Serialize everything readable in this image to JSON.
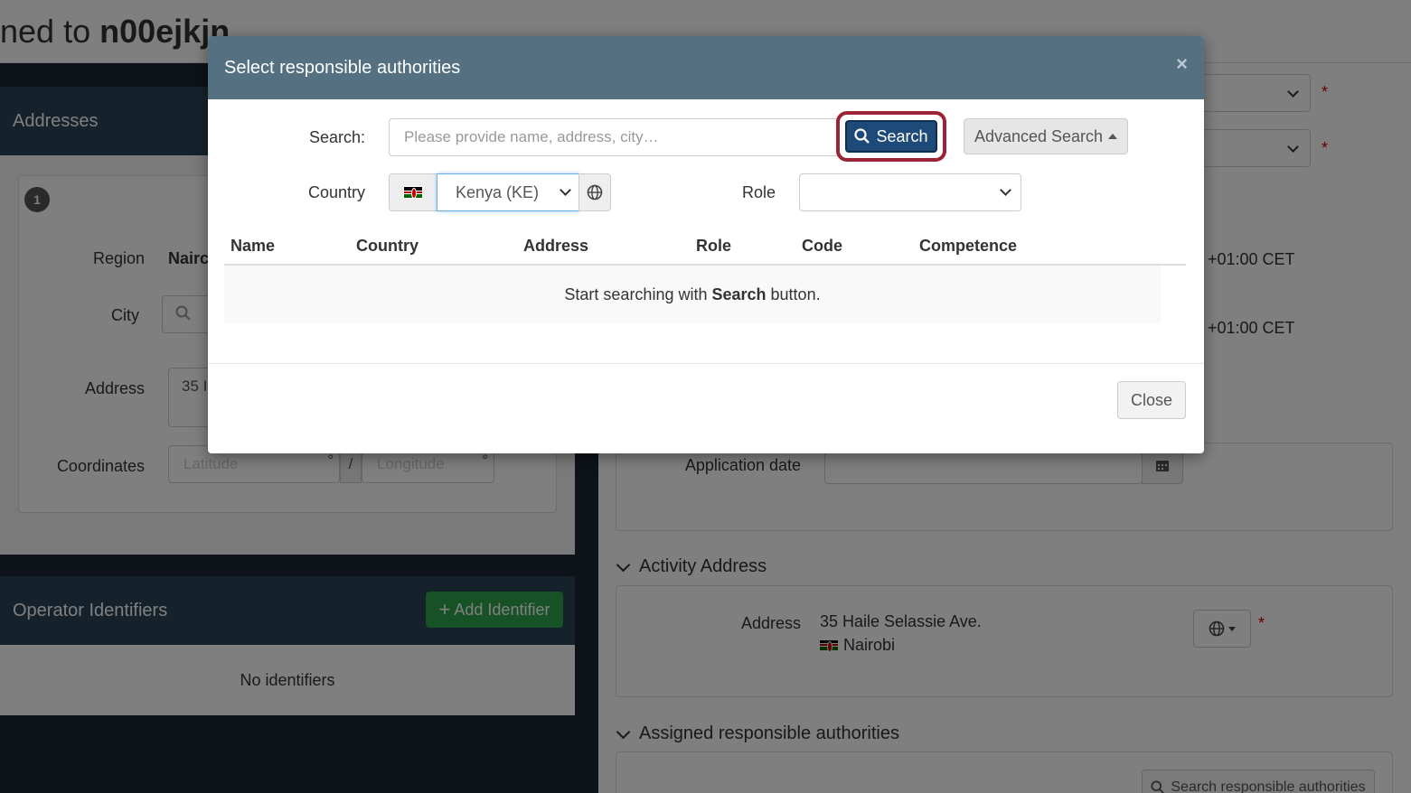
{
  "page": {
    "title_prefix": "ned to",
    "title_user": "n00ejkjn"
  },
  "addresses_panel": {
    "title": "Addresses",
    "index": "1",
    "region_label": "Region",
    "region_value": "Nairc",
    "city_label": "City",
    "address_label": "Address",
    "address_value": "35 I",
    "coordinates_label": "Coordinates",
    "latitude_placeholder": "Latitude",
    "longitude_placeholder": "Longitude",
    "degree_symbol": "°",
    "separator": "/"
  },
  "operator_identifiers": {
    "title": "Operator Identifiers",
    "add_button": "Add Identifier",
    "empty_text": "No identifiers"
  },
  "right_column": {
    "timezone_1": "+01:00 CET",
    "timezone_2": "+01:00 CET",
    "application_date_label": "Application date",
    "activity_address_title": "Activity Address",
    "address_label": "Address",
    "address_line1": "35 Haile Selassie Ave.",
    "address_line2": "Nairobi",
    "assigned_title": "Assigned responsible authorities",
    "search_authorities_button": "Search responsible authorities",
    "required_mark": "*"
  },
  "modal": {
    "title": "Select responsible authorities",
    "close_x": "×",
    "search_label": "Search:",
    "search_placeholder": "Please provide name, address, city…",
    "search_button": "Search",
    "advanced_search_button": "Advanced Search",
    "country_label": "Country",
    "country_value": "Kenya (KE)",
    "role_label": "Role",
    "role_value": "",
    "columns": [
      "Name",
      "Country",
      "Address",
      "Role",
      "Code",
      "Competence"
    ],
    "empty_prefix": "Start searching with",
    "empty_bold": "Search",
    "empty_suffix": "button.",
    "close_button": "Close"
  },
  "colors": {
    "modal_header": "#557080",
    "search_button": "#1d4a78",
    "highlight_ring": "#9c2236",
    "add_button": "#2ea44f",
    "cursor": "#f5c518"
  },
  "icons": [
    "search-icon",
    "globe-icon",
    "kenya-flag-icon",
    "calendar-icon",
    "chevron-down-icon",
    "plus-icon",
    "caret-up-icon",
    "close-icon"
  ]
}
